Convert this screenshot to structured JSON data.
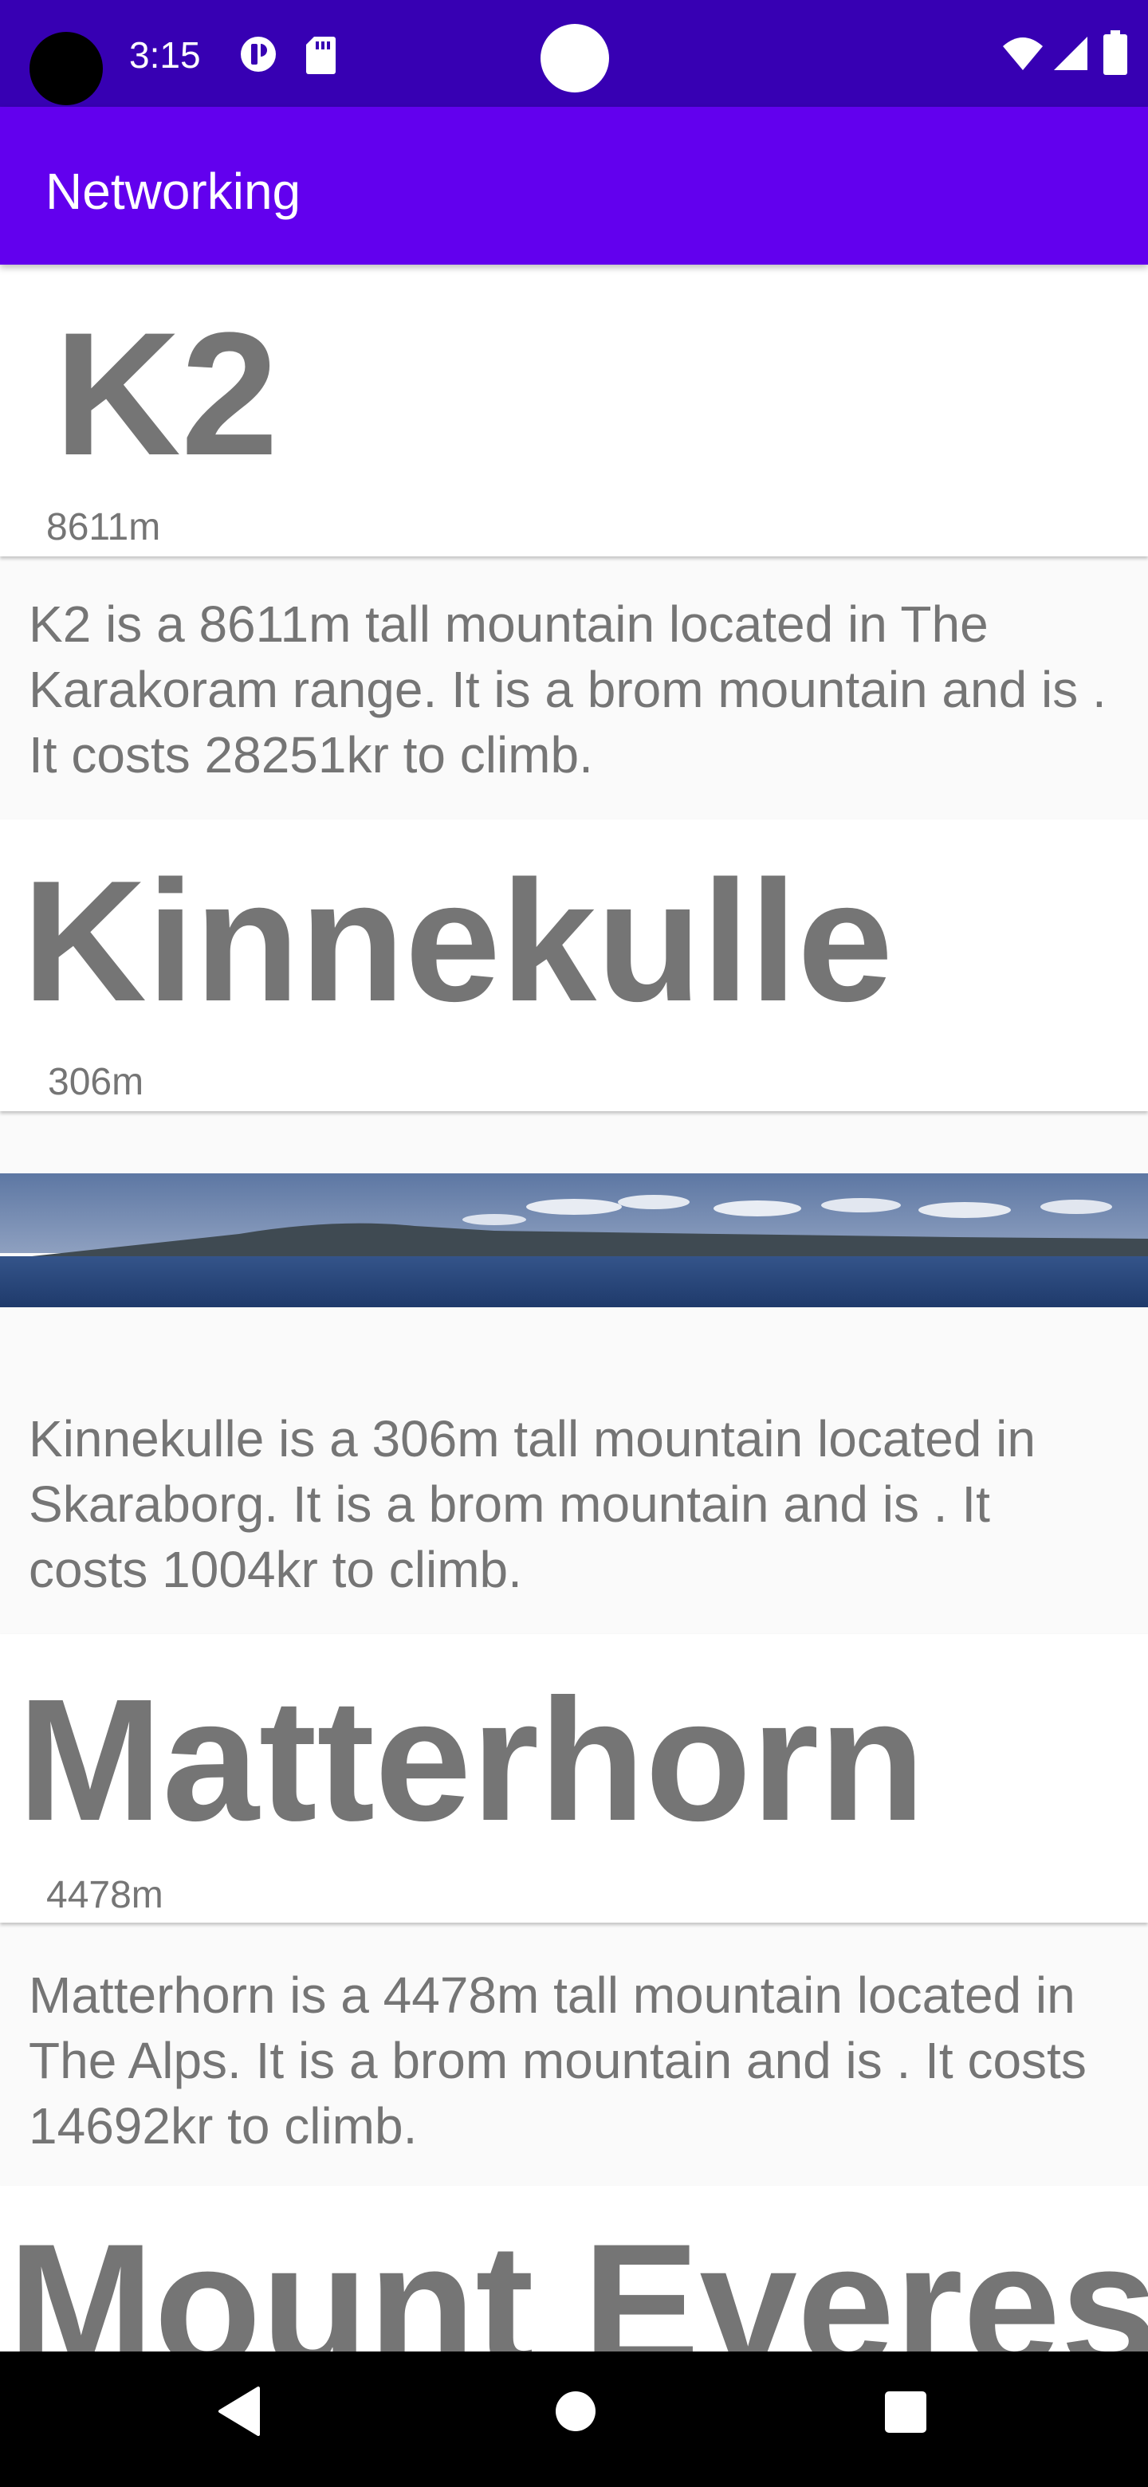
{
  "status_bar": {
    "time": "3:15",
    "icons": [
      "notification-icon",
      "sd-card-icon",
      "wifi-icon",
      "signal-icon",
      "battery-icon"
    ]
  },
  "app_bar": {
    "title": "Networking"
  },
  "mountains": [
    {
      "name": "K2",
      "height": "8611m",
      "description": "K2 is a 8611m tall mountain located in The Karakoram range. It is a brom mountain and is . It costs 28251kr to climb."
    },
    {
      "name": "Kinnekulle",
      "height": "306m",
      "description": "Kinnekulle is a 306m tall mountain located in Skaraborg. It is a brom mountain and is . It costs 1004kr to climb."
    },
    {
      "name": "Matterhorn",
      "height": "4478m",
      "description": "Matterhorn is a 4478m tall mountain located in The Alps. It is a brom mountain and is . It costs 14692kr to climb."
    },
    {
      "name": "Mount Everest"
    }
  ],
  "nav_bar": {
    "icons": [
      "back-icon",
      "home-icon",
      "recents-icon"
    ]
  },
  "colors": {
    "status_bar": "#3700b3",
    "app_bar": "#6200ee",
    "text_grey": "#757575"
  }
}
